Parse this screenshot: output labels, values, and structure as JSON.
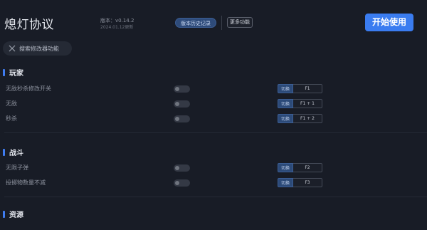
{
  "header": {
    "title": "熄灯协议",
    "version": "版本：v0.14.2",
    "date": "2024.01.12更新",
    "history_btn": "版本历史记录",
    "more_btn": "更多功能",
    "start_btn": "开始使用"
  },
  "search": {
    "placeholder": "搜索修改器功能"
  },
  "sections": [
    {
      "title": "玩家",
      "rows": [
        {
          "label": "无敌秒杀修改开关",
          "switch": "切换",
          "key": "F1"
        },
        {
          "label": "无敌",
          "switch": "切换",
          "key": "F1 + 1"
        },
        {
          "label": "秒杀",
          "switch": "切换",
          "key": "F1 + 2"
        }
      ]
    },
    {
      "title": "战斗",
      "rows": [
        {
          "label": "无限子弹",
          "switch": "切换",
          "key": "F2"
        },
        {
          "label": "投掷物数量不减",
          "switch": "切换",
          "key": "F3"
        }
      ]
    },
    {
      "title": "资源",
      "rows": []
    }
  ],
  "colors": {
    "accent": "#3a7cf0",
    "background": "#181c26"
  }
}
